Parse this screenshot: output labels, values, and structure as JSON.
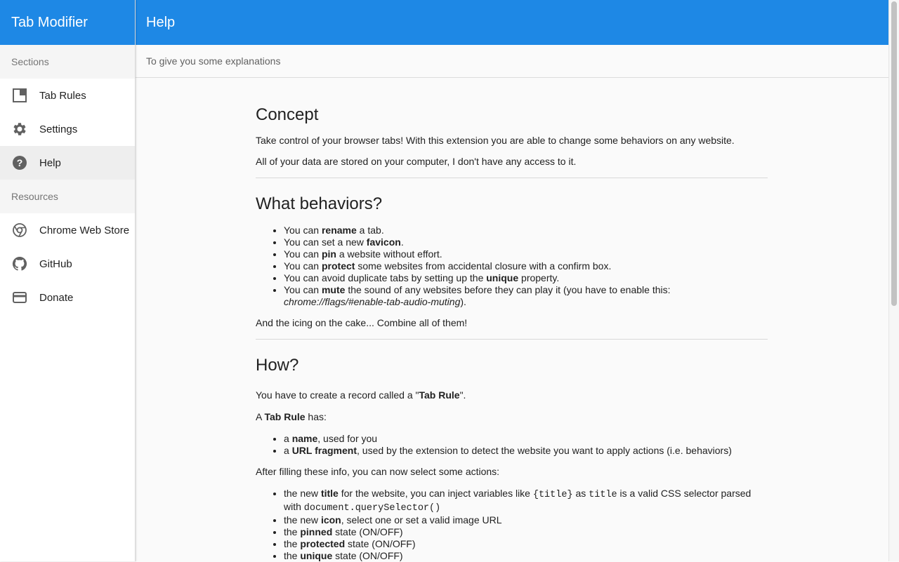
{
  "sidebar": {
    "title": "Tab Modifier",
    "sections_label": "Sections",
    "items": [
      {
        "label": "Tab Rules",
        "icon": "tab-icon"
      },
      {
        "label": "Settings",
        "icon": "gear-icon"
      },
      {
        "label": "Help",
        "icon": "help-circle-icon",
        "active": true
      }
    ],
    "resources_label": "Resources",
    "resources": [
      {
        "label": "Chrome Web Store",
        "icon": "chrome-icon"
      },
      {
        "label": "GitHub",
        "icon": "github-icon"
      },
      {
        "label": "Donate",
        "icon": "credit-card-icon"
      }
    ]
  },
  "toolbar": {
    "title": "Help"
  },
  "subheader": {
    "text": "To give you some explanations"
  },
  "colors": {
    "accent": "#1e88e5",
    "active_item": "#eeeeee"
  },
  "concept": {
    "heading": "Concept",
    "p1": "Take control of your browser tabs! With this extension you are able to change some behaviors on any website.",
    "p2": "All of your data are stored on your computer, I don't have any access to it."
  },
  "behaviors": {
    "heading": "What behaviors?",
    "items": [
      {
        "pre": "You can ",
        "bold": "rename",
        "post": " a tab."
      },
      {
        "pre": "You can set a new ",
        "bold": "favicon",
        "post": "."
      },
      {
        "pre": "You can ",
        "bold": "pin",
        "post": " a website without effort."
      },
      {
        "pre": "You can ",
        "bold": "protect",
        "post": " some websites from accidental closure with a confirm box."
      },
      {
        "pre": "You can avoid duplicate tabs by setting up the ",
        "bold": "unique",
        "post": " property."
      },
      {
        "pre": "You can ",
        "bold": "mute",
        "post": " the sound of any websites before they can play it (you have to enable this: ",
        "italic": "chrome://flags/#enable-tab-audio-muting",
        "post2": ")."
      }
    ],
    "footer": "And the icing on the cake... Combine all of them!"
  },
  "how": {
    "heading": "How?",
    "p1_pre": "You have to create a record called a \"",
    "p1_bold": "Tab Rule",
    "p1_post": "\".",
    "p2_pre": "A ",
    "p2_bold": "Tab Rule",
    "p2_post": " has:",
    "rule_items": [
      {
        "pre": "a ",
        "bold": "name",
        "post": ", used for you"
      },
      {
        "pre": "a ",
        "bold": "URL fragment",
        "post": ", used by the extension to detect the website you want to apply actions (i.e. behaviors)"
      }
    ],
    "p3": "After filling these info, you can now select some actions:",
    "actions": {
      "title": {
        "pre": "the new ",
        "bold": "title",
        "mid": " for the website, you can inject variables like ",
        "code1": "{title}",
        "mid2": " as ",
        "code2": "title",
        "mid3": " is a valid CSS selector parsed with ",
        "code3": "document.querySelector()"
      },
      "icon": {
        "pre": "the new ",
        "bold": "icon",
        "post": ", select one or set a valid image URL"
      },
      "pinned": {
        "pre": "the ",
        "bold": "pinned",
        "post": " state (ON/OFF)"
      },
      "protected": {
        "pre": "the ",
        "bold": "protected",
        "post": " state (ON/OFF)"
      },
      "unique": {
        "pre": "the ",
        "bold": "unique",
        "post": " state (ON/OFF)"
      }
    }
  }
}
